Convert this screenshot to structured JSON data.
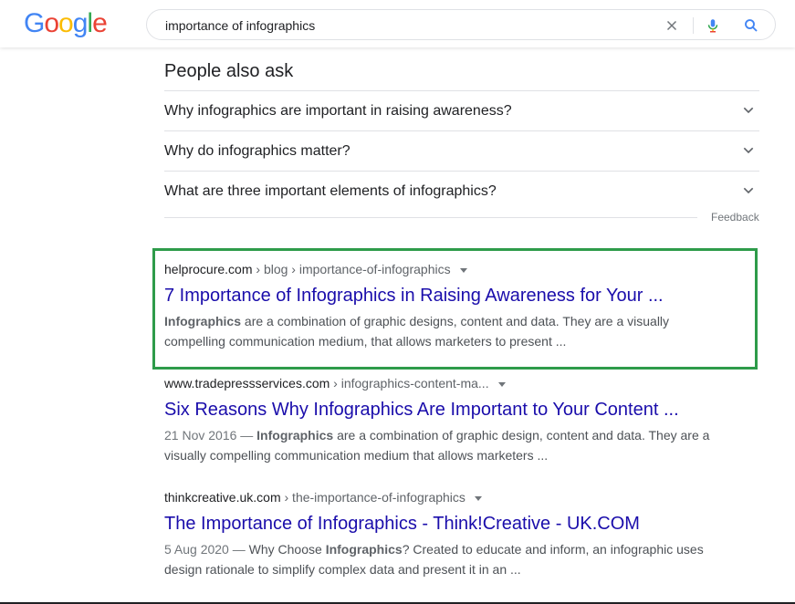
{
  "logo": {
    "text": "Google",
    "letters": [
      "G",
      "o",
      "o",
      "g",
      "l",
      "e"
    ],
    "colors": [
      "#4285f4",
      "#ea4335",
      "#fbbc05",
      "#4285f4",
      "#34a853",
      "#ea4335"
    ]
  },
  "search": {
    "value": "importance of infographics",
    "icons": [
      "close-icon",
      "mic-icon",
      "search-icon"
    ]
  },
  "people_also_ask": {
    "title": "People also ask",
    "questions": [
      "Why infographics are important in raising awareness?",
      "Why do infographics matter?",
      "What are three important elements of infographics?"
    ],
    "feedback": "Feedback"
  },
  "results": [
    {
      "domain": "helprocure.com",
      "crumbs": " › blog › importance-of-infographics",
      "title": "7 Importance of Infographics in Raising Awareness for Your ...",
      "date": "",
      "snippet_bold": "Infographics",
      "snippet_rest": " are a combination of graphic designs, content and data. They are a visually compelling communication medium, that allows marketers to present ...",
      "highlighted": true
    },
    {
      "domain": "www.tradepressservices.com",
      "crumbs": " › infographics-content-ma...",
      "title": "Six Reasons Why Infographics Are Important to Your Content ...",
      "date": "21 Nov 2016 — ",
      "snippet_bold": "Infographics",
      "snippet_rest": " are a combination of graphic design, content and data. They are a visually compelling communication medium that allows marketers ...",
      "highlighted": false
    },
    {
      "domain": "thinkcreative.uk.com",
      "crumbs": " › the-importance-of-infographics",
      "title": "The Importance of Infographics - Think!Creative - UK.COM",
      "date": "5 Aug 2020 — ",
      "snippet_pre": "Why Choose ",
      "snippet_bold": "Infographics",
      "snippet_rest": "? Created to educate and inform, an infographic uses design rationale to simplify complex data and present it in an ...",
      "highlighted": false
    }
  ],
  "colors": {
    "link": "#1a0dab",
    "highlight_box": "#2e9b4a",
    "text": "#202124",
    "snippet": "#4d5156"
  }
}
